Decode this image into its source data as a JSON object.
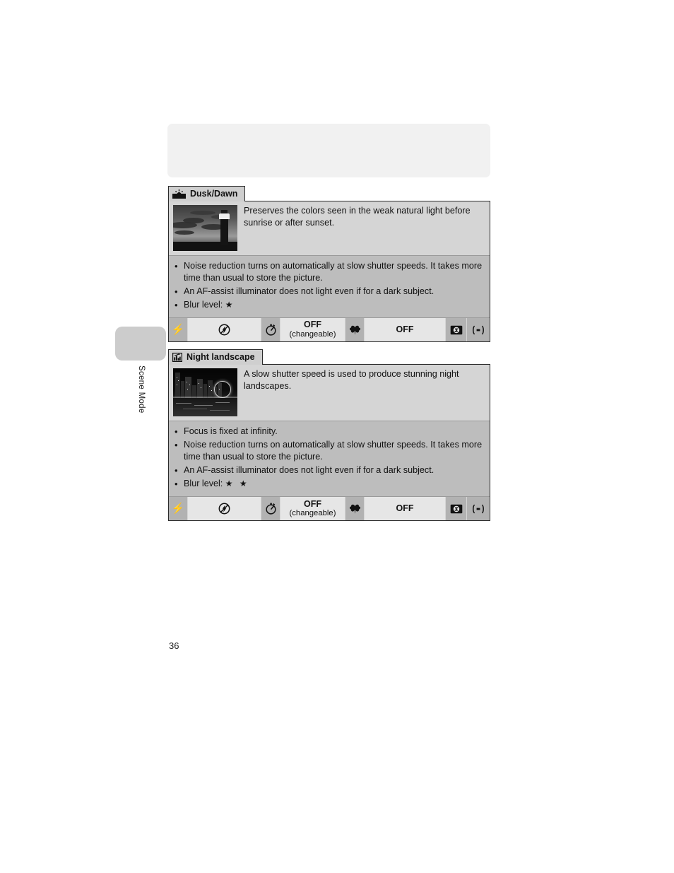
{
  "page": {
    "number": "36",
    "side_tab_label": "Scene Mode"
  },
  "sections": [
    {
      "id": "dusk",
      "icon_name": "dusk-dawn-icon",
      "title": "Dusk/Dawn",
      "thumbnail_name": "dusk-lighthouse-photo",
      "description": "Preserves the colors seen in the weak natural light before sunrise or after sunset.",
      "notes": [
        "Noise reduction turns on automatically at slow shutter speeds. It takes more time than usual to store the picture.",
        "An AF-assist illuminator does not light even if for a dark subject."
      ],
      "blur_label": "Blur level:",
      "blur_stars": "★",
      "settings": {
        "flash_icon": "flash-icon",
        "flash_mode_icon": "flash-off-icon",
        "timer_icon": "self-timer-icon",
        "timer_value": "OFF",
        "timer_value_sub": "(changeable)",
        "macro_icon": "macro-icon",
        "macro_value": "OFF",
        "exposure_icon": "exposure-compensation-icon",
        "af_icon": "af-area-icon"
      }
    },
    {
      "id": "night",
      "icon_name": "night-landscape-icon",
      "title": "Night landscape",
      "thumbnail_name": "night-city-skyline-photo",
      "description": "A slow shutter speed is used to produce stunning night landscapes.",
      "notes": [
        "Focus is fixed at infinity.",
        "Noise reduction turns on automatically at slow shutter speeds. It takes more time than usual to store the picture.",
        "An AF-assist illuminator does not light even if for a dark subject."
      ],
      "blur_label": "Blur level:",
      "blur_stars": "★ ★",
      "settings": {
        "flash_icon": "flash-icon",
        "flash_mode_icon": "flash-off-icon",
        "timer_icon": "self-timer-icon",
        "timer_value": "OFF",
        "timer_value_sub": "(changeable)",
        "macro_icon": "macro-icon",
        "macro_value": "OFF",
        "exposure_icon": "exposure-compensation-icon",
        "af_icon": "af-area-icon"
      }
    }
  ],
  "colors": {
    "panel_bg": "#d5d5d5",
    "notes_bg": "#bdbdbd",
    "tab_bg": "#cfcfcf",
    "border": "#2b2b2b",
    "value_cell": "#e6e6e6",
    "icon_cell": "#b2b2b2",
    "placeholder": "#f1f1f1"
  }
}
